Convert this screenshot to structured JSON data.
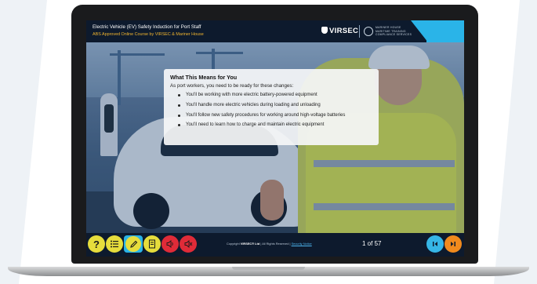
{
  "header": {
    "course_title": "Electric Vehicle (EV) Safety Induction for Port Staff",
    "course_subtitle": "ABS Approved Online Course by VIRSEC & Mariner House",
    "brand": "VIRSEC",
    "partner_lines": [
      "MARINER HOUSE",
      "MARITIME TRAINING",
      "COMPLIANCE SERVICES"
    ]
  },
  "content": {
    "title": "What This Means for You",
    "intro": "As port workers, you need to be ready for these changes:",
    "bullets": [
      "You'll be working with more electric battery-powered equipment",
      "You'll handle more electric vehicles during loading and unloading",
      "You'll follow new safety procedures for working around high-voltage batteries",
      "You'll need to learn how to charge and maintain electric equipment"
    ]
  },
  "footer": {
    "copyright_prefix": "Copyright",
    "company": "VIRSEC® Ltd",
    "rights": "| All Rights Reserved |",
    "security_link": "Security Notice",
    "pager": "1 of 57",
    "buttons": {
      "help": "?",
      "menu_icon": "list-icon",
      "edit_icon": "pencil-icon",
      "transcript_icon": "document-icon",
      "audio_icon": "speaker-icon",
      "mute_icon": "speaker-mute-icon",
      "first_icon": "first-page-icon",
      "last_icon": "last-page-icon"
    }
  },
  "colors": {
    "header_bg": "#0d1a2d",
    "accent_blue": "#2ab4e8",
    "subtitle_gold": "#f2b52e",
    "button_yellow": "#e6dd3c",
    "button_red": "#e02b38",
    "button_orange": "#f08a1d"
  }
}
